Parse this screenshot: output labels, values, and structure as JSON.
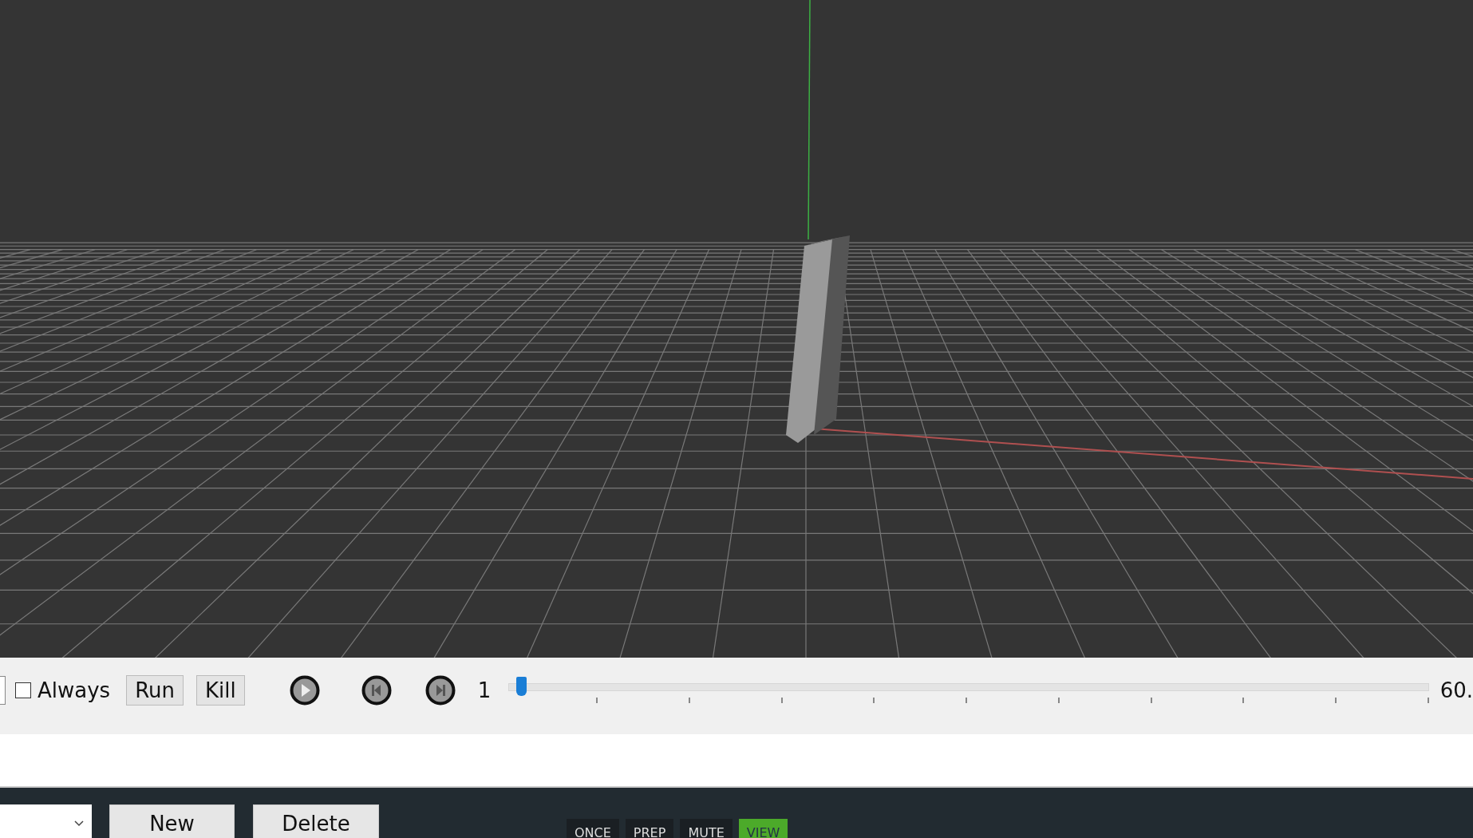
{
  "toolbar": {
    "always": {
      "label": "Always",
      "checked": false
    },
    "buttons": [
      "Run",
      "Kill"
    ],
    "frame_start": "1",
    "slider": {
      "level": 0.01
    },
    "frame_end": "60."
  },
  "bottom_bar": {
    "buttons": [
      "New",
      "Delete"
    ],
    "modes": [
      {
        "label": "ONCE",
        "selected": false
      },
      {
        "label": "PREP",
        "selected": false
      },
      {
        "label": "MUTE",
        "selected": false
      },
      {
        "label": "VIEW",
        "selected": true
      }
    ]
  }
}
